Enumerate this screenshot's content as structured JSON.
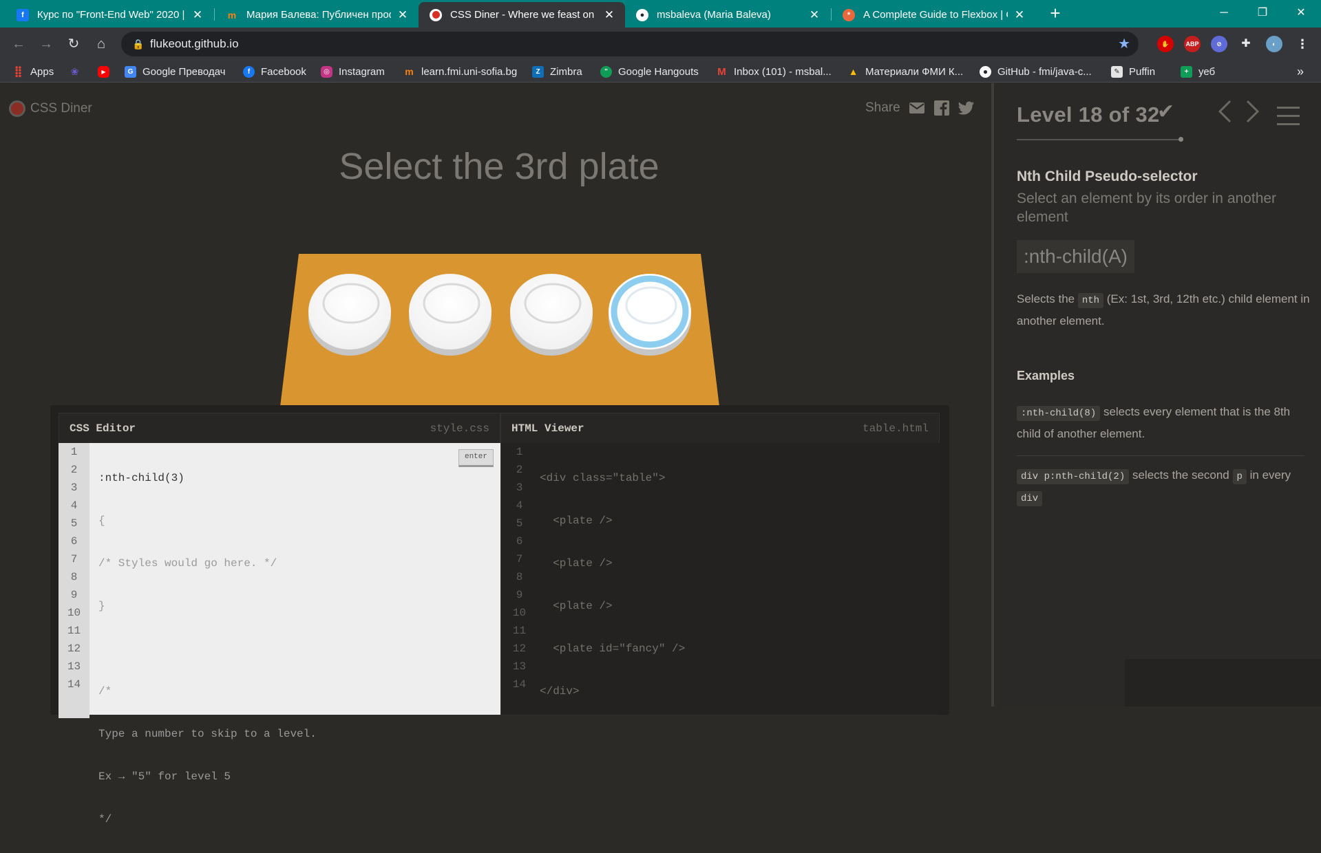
{
  "browser": {
    "tabs": [
      {
        "title": "Курс по \"Front-End Web\" 2020 |",
        "icon": "facebook-icon",
        "color": "#1877f2"
      },
      {
        "title": "Мария Балева: Публичен проф",
        "icon": "moodle-icon",
        "color": "#f98012"
      },
      {
        "title": "CSS Diner - Where we feast on C",
        "icon": "css-diner-icon",
        "color": "#d93025"
      },
      {
        "title": "msbaleva (Maria Baleva)",
        "icon": "github-icon",
        "color": "#24292e"
      },
      {
        "title": "A Complete Guide to Flexbox | C",
        "icon": "css-tricks-icon",
        "color": "#e8693e"
      }
    ],
    "url": "flukeout.github.io",
    "bookmarks": [
      {
        "label": "Apps",
        "icon": "apps-icon",
        "color": "#ea4335"
      },
      {
        "label": "",
        "icon": "link-icon",
        "color": "#6b5bd6"
      },
      {
        "label": "",
        "icon": "youtube-icon",
        "color": "#ff0000"
      },
      {
        "label": "Google Преводач",
        "icon": "google-translate-icon",
        "color": "#4285f4"
      },
      {
        "label": "Facebook",
        "icon": "facebook-icon",
        "color": "#1877f2"
      },
      {
        "label": "Instagram",
        "icon": "instagram-icon",
        "color": "#c13584"
      },
      {
        "label": "learn.fmi.uni-sofia.bg",
        "icon": "moodle-icon",
        "color": "#f98012"
      },
      {
        "label": "Zimbra",
        "icon": "zimbra-icon",
        "color": "#0e6eb8"
      },
      {
        "label": "Google Hangouts",
        "icon": "hangouts-icon",
        "color": "#0f9d58"
      },
      {
        "label": "Inbox (101) - msbal...",
        "icon": "gmail-icon",
        "color": "#ea4335"
      },
      {
        "label": "Материали ФМИ К...",
        "icon": "google-drive-icon",
        "color": "#fbbc04"
      },
      {
        "label": "GitHub - fmi/java-c...",
        "icon": "github-icon",
        "color": "#24292e"
      },
      {
        "label": "Puffin",
        "icon": "puffin-icon",
        "color": "#e4e4e4"
      },
      {
        "label": "уеб",
        "icon": "sheets-icon",
        "color": "#0f9d58"
      }
    ],
    "more_bookmarks": "»"
  },
  "app": {
    "logo": "CSS Diner",
    "share_label": "Share",
    "instruction": "Select the 3rd plate",
    "board": {
      "plates": 4,
      "fancy_plate_index": 4,
      "fancy_ring_color": "#8ccdf0",
      "table_color": "#d99530"
    }
  },
  "editor": {
    "css_title": "CSS Editor",
    "css_file": "style.css",
    "html_title": "HTML Viewer",
    "html_file": "table.html",
    "enter_label": "enter",
    "css_lines": [
      ":nth-child(3)",
      "{",
      "/* Styles would go here. */",
      "}",
      "",
      "/*",
      "Type a number to skip to a level.",
      "Ex → \"5\" for level 5",
      "*/",
      "",
      "",
      "",
      "",
      ""
    ],
    "html_lines": [
      "<div class=\"table\">",
      "  <plate />",
      "  <plate />",
      "  <plate />",
      "  <plate id=\"fancy\" />",
      "</div>",
      "",
      "",
      "",
      "",
      "",
      "",
      "",
      ""
    ],
    "line_numbers": [
      "1",
      "2",
      "3",
      "4",
      "5",
      "6",
      "7",
      "8",
      "9",
      "10",
      "11",
      "12",
      "13",
      "14"
    ]
  },
  "sidebar": {
    "level_text": "Level 18 of 32",
    "level": 18,
    "level_total": 32,
    "title": "Nth Child Pseudo-selector",
    "subtitle": "Select an element by its order in another element",
    "syntax": ":nth-child(A)",
    "desc_before": "Selects the ",
    "desc_code": "nth",
    "desc_after": " (Ex: 1st, 3rd, 12th etc.) child element in another element.",
    "examples_heading": "Examples",
    "example1_code": ":nth-child(8)",
    "example1_text": " selects every element that is the 8th child of another element.",
    "example2_code": "div p:nth-child(2)",
    "example2_mid": " selects the second ",
    "example2_code2": "p",
    "example2_mid2": " in every ",
    "example2_code3": "div"
  }
}
